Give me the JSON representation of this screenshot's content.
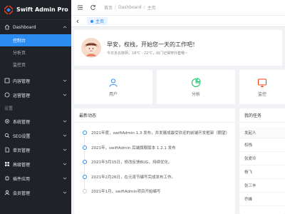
{
  "app": {
    "title": "Swift Admin Pro"
  },
  "sidebar": {
    "dashboard": {
      "label": "Dashboard",
      "items": [
        {
          "label": "控制台",
          "active": true
        },
        {
          "label": "分析页"
        },
        {
          "label": "监控页"
        }
      ]
    },
    "groups_top": [
      {
        "label": "内容管理",
        "icon": "content-icon"
      },
      {
        "label": "运营管理",
        "icon": "operation-icon"
      }
    ],
    "section_label": "设置",
    "groups_bottom": [
      {
        "label": "系统管理",
        "icon": "gear-icon"
      },
      {
        "label": "SEO设置",
        "icon": "seo-icon"
      },
      {
        "label": "单页管理",
        "icon": "page-icon"
      },
      {
        "label": "高级管理",
        "icon": "advanced-icon"
      },
      {
        "label": "插件应用",
        "icon": "plugin-icon"
      },
      {
        "label": "会员管理",
        "icon": "member-icon"
      }
    ]
  },
  "breadcrumb": [
    "首页",
    "Dashboard",
    "主页"
  ],
  "tabs": [
    {
      "label": "主页"
    }
  ],
  "welcome": {
    "title": "早安，权栈，开始您一天的工作吧！",
    "subtitle": "今日多云转阴，18℃ - 22℃，出门记得穿外套哦~"
  },
  "quick": [
    {
      "label": "用户",
      "icon": "user-icon",
      "color": "#2d8cf0"
    },
    {
      "label": "分析",
      "icon": "analytics-icon",
      "color": "#19be6b"
    },
    {
      "label": "监控",
      "icon": "monitor-icon",
      "color": "#ed4014"
    }
  ],
  "news": {
    "title": "最新动态",
    "items": [
      "2021年度，swiftAdmin 1.3 发布，并发展成最受欢迎的前端开发框架（期望）",
      "2021年，swiftAdmin 后端旗舰版本 1.2.1 发布",
      "2021年3月15日，修改反馈BUG，持续优化。",
      "2021年2月26日，在元宵节编写完成发布工作。",
      "2021年1月，swiftAdmin项目开始编写"
    ]
  },
  "tasks": {
    "title": "我的任务",
    "header": "发起人",
    "rows": [
      "权栈",
      "张爱玲",
      "杨飞",
      "张三丰",
      "乔峰"
    ]
  },
  "colors": {
    "accent": "#2d8cf0",
    "sidebar_bg": "#20222a"
  }
}
